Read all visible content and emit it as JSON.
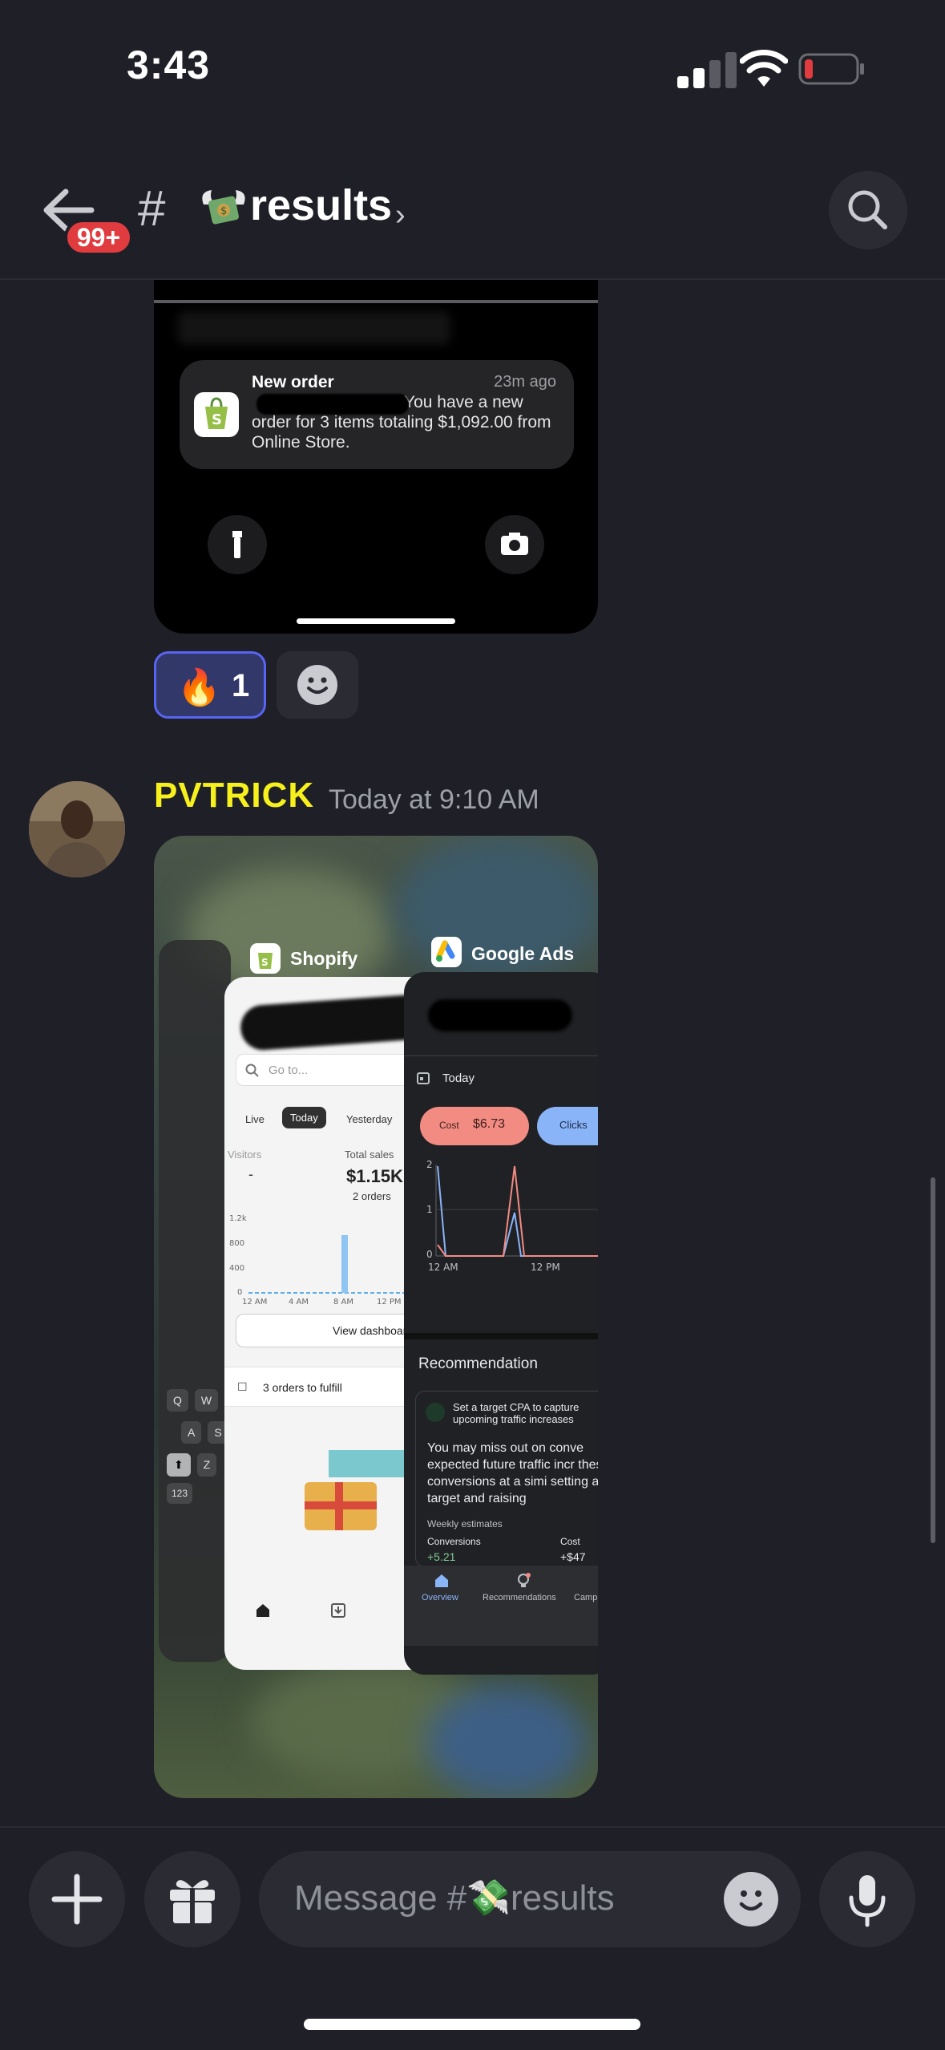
{
  "status": {
    "time": "3:43"
  },
  "header": {
    "unread_badge": "99+",
    "hash": "#",
    "channel_name": "results",
    "chevron": "›",
    "icons": {
      "back": "arrow-left-icon",
      "search": "search-icon",
      "channel_emoji": "money-with-wings-icon"
    }
  },
  "attachment1": {
    "notification": {
      "title": "New order",
      "time": "23m ago",
      "body": "You have a new order for 3 items totaling $1,092.00 from Online Store."
    }
  },
  "reactions": [
    {
      "emoji": "🔥",
      "count": "1",
      "selected": true
    }
  ],
  "message": {
    "username": "PVTRICK",
    "username_color": "#f6f11c",
    "timestamp": "Today at 9:10 AM"
  },
  "attachment2": {
    "shopify": {
      "app_label": "Shopify",
      "search_placeholder": "Go to...",
      "tabs": [
        "Live",
        "Today",
        "Yesterday"
      ],
      "visitors_label": "Visitors",
      "visitors_value": "-",
      "total_sales_label": "Total sales",
      "total_sales_value": "$1.15K",
      "orders_label": "2 orders",
      "chart_y_ticks": [
        "1.2k",
        "800",
        "400",
        "0"
      ],
      "chart_x_ticks": [
        "12 AM",
        "4 AM",
        "8 AM",
        "12 PM"
      ],
      "view_dashboard": "View dashboard",
      "fulfill_text": "3 orders to fulfill"
    },
    "google_ads": {
      "app_label": "Google Ads",
      "date_label": "Today",
      "cost_label": "Cost",
      "cost_value": "$6.73",
      "clicks_label": "Clicks",
      "chart_y_ticks": [
        "2",
        "1",
        "0"
      ],
      "chart_x_ticks": [
        "12 AM",
        "12 PM"
      ],
      "recommendation_title": "Recommendation",
      "rec_chip": "Set a target CPA to capture upcoming traffic increases",
      "rec_body": "You may miss out on conve expected future traffic incr these conversions at a simi setting a target and raising",
      "weekly_estimates": "Weekly estimates",
      "conversions_label": "Conversions",
      "cost_col_label": "Cost",
      "conversions_value": "+5.21",
      "cost_col_value": "+$47",
      "nav": [
        "Overview",
        "Recommendations",
        "Camp"
      ]
    },
    "keyboard_keys": [
      "Q",
      "W",
      "A",
      "S",
      "Z",
      "123"
    ]
  },
  "composer": {
    "placeholder": "Message #💸results",
    "icons": {
      "add": "plus-icon",
      "gift": "gift-icon",
      "emoji": "emoji-face-icon",
      "mic": "microphone-icon"
    }
  },
  "colors": {
    "background": "#1f1f27",
    "surface": "#2b2c33",
    "accent": "#5865f2",
    "badge": "#e03c3f"
  }
}
